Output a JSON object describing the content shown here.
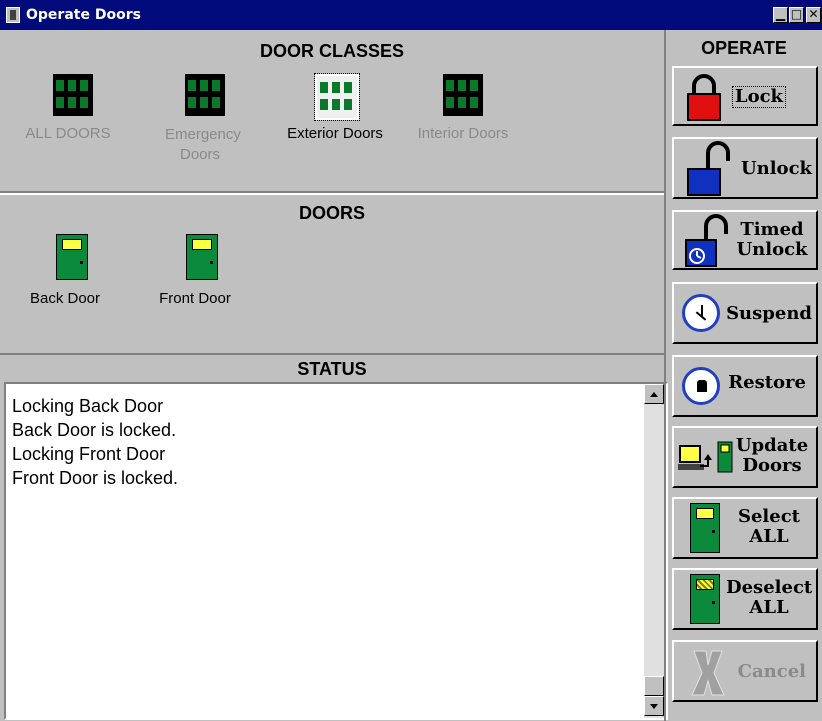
{
  "window": {
    "title": "Operate Doors",
    "min_symbol": "▁",
    "max_symbol": "□",
    "close_symbol": "✕"
  },
  "door_classes": {
    "title": "DOOR CLASSES",
    "items": [
      {
        "label": "ALL DOORS",
        "enabled": false
      },
      {
        "label": "Emergency Doors",
        "enabled": false
      },
      {
        "label": "Exterior Doors",
        "enabled": true
      },
      {
        "label": "Interior Doors",
        "enabled": false
      }
    ]
  },
  "doors": {
    "title": "DOORS",
    "items": [
      {
        "label": "Back Door"
      },
      {
        "label": "Front Door"
      }
    ]
  },
  "status": {
    "title": "STATUS",
    "lines": [
      "Locking Back Door",
      "Back Door is locked.",
      "Locking Front Door",
      "Front Door is locked."
    ]
  },
  "operate": {
    "title": "OPERATE",
    "buttons": [
      {
        "label": "Lock",
        "icon": "padlock-locked-icon",
        "enabled": true
      },
      {
        "label": "Unlock",
        "icon": "padlock-open-icon",
        "enabled": true
      },
      {
        "label": "Timed Unlock",
        "icon": "padlock-timer-icon",
        "enabled": true
      },
      {
        "label": "Suspend",
        "icon": "clock-icon",
        "enabled": true
      },
      {
        "label": "Restore",
        "icon": "clock-lock-icon",
        "enabled": true
      },
      {
        "label": "Update Doors",
        "icon": "computer-door-icon",
        "enabled": true
      },
      {
        "label": "Select ALL",
        "icon": "door-icon",
        "enabled": true
      },
      {
        "label": "Deselect ALL",
        "icon": "door-hatched-icon",
        "enabled": true
      },
      {
        "label": "Cancel",
        "icon": "cancel-x-icon",
        "enabled": false
      }
    ]
  },
  "colors": {
    "titlebar": "#000a7a",
    "door_green": "#0a8a3a",
    "door_window": "#ffff44",
    "lock_red": "#e01010",
    "lock_blue": "#1030c0"
  }
}
